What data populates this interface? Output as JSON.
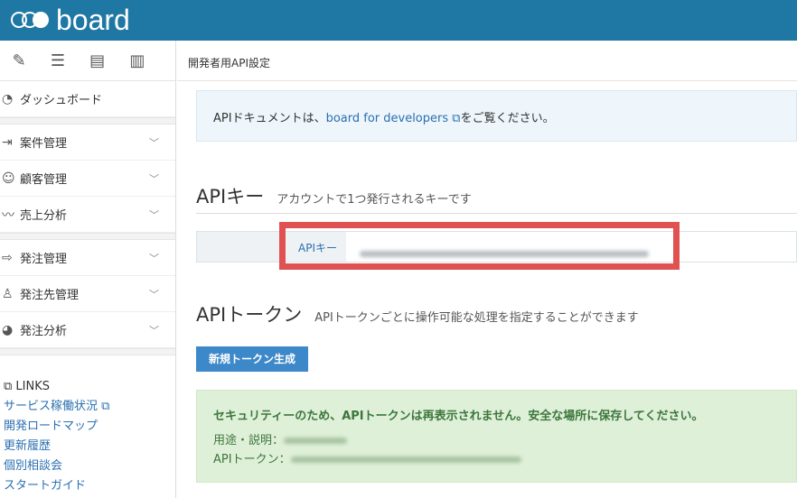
{
  "header": {
    "logo": "board"
  },
  "sidebar": {
    "icon_tabs": [
      "pencil-icon",
      "list-icon",
      "list-box-icon",
      "chart-icon"
    ],
    "items": [
      {
        "label": "ダッシュボード",
        "icon": "gauge-icon",
        "chevron": false
      },
      {
        "label": "案件管理",
        "icon": "login-icon",
        "chevron": true
      },
      {
        "label": "顧客管理",
        "icon": "users-icon",
        "chevron": true
      },
      {
        "label": "売上分析",
        "icon": "trend-icon",
        "chevron": true
      },
      {
        "label": "発注管理",
        "icon": "arrow-icon",
        "chevron": true
      },
      {
        "label": "発注先管理",
        "icon": "user-icon",
        "chevron": true
      },
      {
        "label": "発注分析",
        "icon": "pie-icon",
        "chevron": true
      }
    ],
    "links_title": "LINKS",
    "links": [
      "サービス稼働状況",
      "開発ロードマップ",
      "更新履歴",
      "個別相談会",
      "スタートガイド"
    ]
  },
  "page": {
    "title": "開発者用API設定",
    "info_prefix": "APIドキュメントは、",
    "info_link": "board for developers",
    "info_suffix": "をご覧ください。",
    "api_key_heading": "APIキー",
    "api_key_sub": "アカウントで1つ発行されるキーです",
    "api_key_label": "APIキー",
    "api_token_heading": "APIトークン",
    "api_token_sub": "APIトークンごとに操作可能な処理を指定することができます",
    "new_token_button": "新規トークン生成",
    "notice_title": "セキュリティーのため、APIトークンは再表示されません。安全な場所に保存してください。",
    "notice_usage_label": "用途・説明：",
    "notice_token_label": "APIトークン：",
    "highlight_color": "#e05252"
  }
}
